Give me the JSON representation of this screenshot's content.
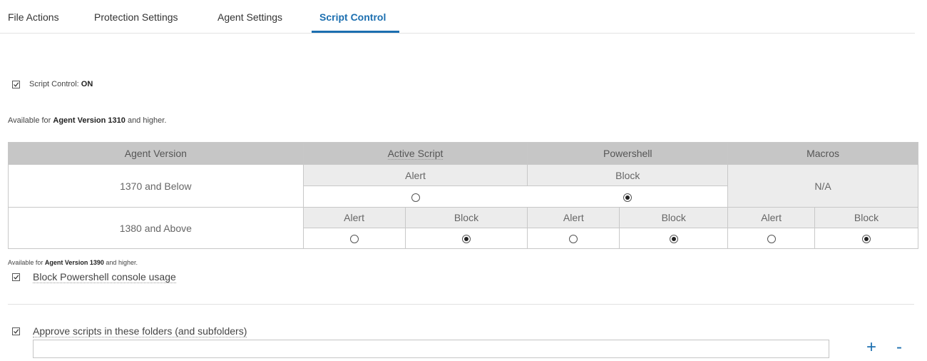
{
  "tabs": [
    {
      "label": "File Actions"
    },
    {
      "label": "Protection Settings"
    },
    {
      "label": "Agent Settings"
    },
    {
      "label": "Script Control"
    }
  ],
  "script_control": {
    "label": "Script Control:",
    "state": "ON",
    "checked": true
  },
  "availability_1": {
    "prefix": "Available for ",
    "bold": "Agent Version 1310",
    "suffix": " and higher."
  },
  "table": {
    "headers": [
      "Agent Version",
      "Active Script",
      "Powershell",
      "Macros"
    ],
    "row1": {
      "version": "1370 and Below",
      "active_label": "Alert",
      "powershell_label": "Block",
      "macros": "N/A"
    },
    "row2": {
      "version": "1380 and Above",
      "alert": "Alert",
      "block": "Block"
    }
  },
  "availability_2": {
    "prefix": "Available for ",
    "bold": "Agent Version 1390",
    "suffix": " and higher."
  },
  "block_console": {
    "label": "Block Powershell console usage",
    "checked": true
  },
  "approve_folders": {
    "label": "Approve scripts in these folders (and subfolders)",
    "checked": true,
    "value": ""
  },
  "buttons": {
    "add": "+",
    "remove": "-"
  },
  "colors": {
    "accent": "#1c6fb0",
    "header_bg": "#c6c6c6",
    "cell_bg": "#ececec"
  }
}
